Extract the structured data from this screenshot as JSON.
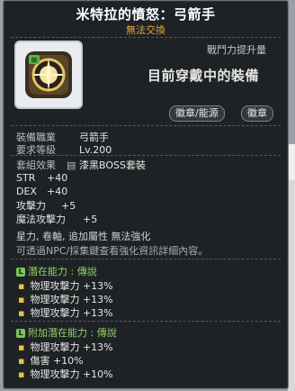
{
  "item": {
    "name": "米特拉的憤怒：弓箭手",
    "trade_status": "無法交換",
    "power_label": "戰鬥力提升量",
    "equipped_text": "目前穿戴中的裝備",
    "tags": [
      "徽章/能源",
      "徽章"
    ],
    "req_job_label": "裝備職業",
    "req_job_value": "弓箭手",
    "req_level_label": "要求等級",
    "req_level_value": "Lv.200",
    "set_label": "套組效果",
    "set_value": "漆黑BOSS套裝",
    "stats": [
      {
        "name": "STR",
        "value": "+40"
      },
      {
        "name": "DEX",
        "value": "+40"
      },
      {
        "name": "攻擊力",
        "value": "+5"
      },
      {
        "name": "魔法攻擊力",
        "value": "+5"
      }
    ],
    "enhance_text": "星力, 卷軸, 追加屬性 無法強化",
    "note_text": "可透過NPC/採集鍵查看強化資訊詳細內容。",
    "potential": {
      "badge": "L",
      "title": "潛在能力 : 傳說",
      "lines": [
        "物理攻擊力 +13%",
        "物理攻擊力 +13%",
        "物理攻擊力 +13%"
      ]
    },
    "additional": {
      "badge": "L",
      "title": "附加潛在能力 : 傳說",
      "lines": [
        "物理攻擊力 +13%",
        "傷害 +10%",
        "物理攻擊力 +10%"
      ]
    }
  },
  "colors": {
    "potential_green": "#8fd16a",
    "trade_orange": "#e8a23a",
    "bullet_gold": "#e6c24a"
  },
  "icons": {
    "item": "emblem-icon",
    "set_lock": "lock-icon"
  }
}
